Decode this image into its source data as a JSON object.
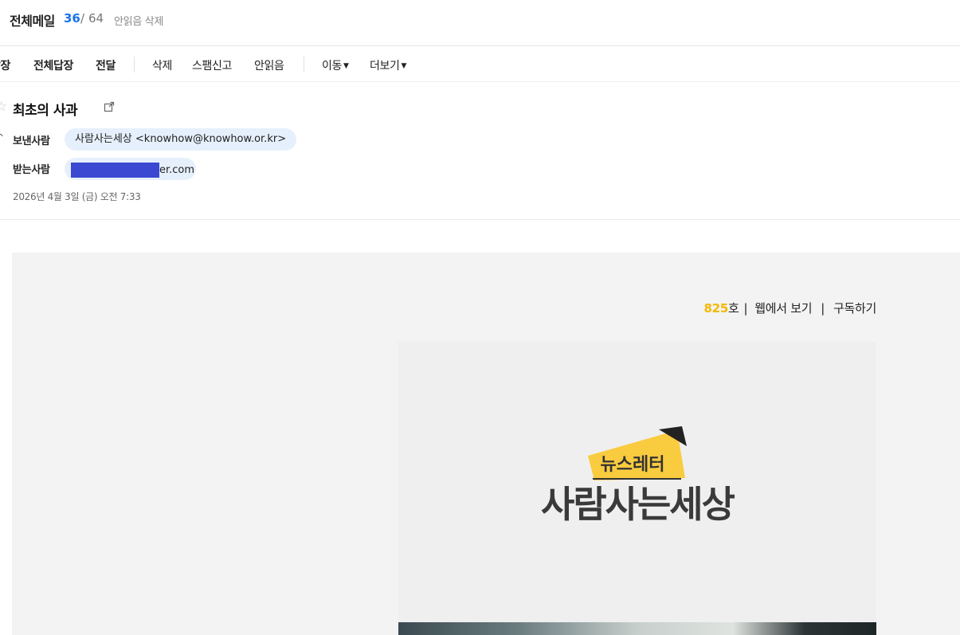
{
  "header": {
    "folder_title": "전체메일",
    "unread_count": "36",
    "separator": "/",
    "total_count": "64",
    "delete_unread_label": "안읽음 삭제"
  },
  "toolbar": {
    "reply_label": "답장",
    "reply_all_label": "전체답장",
    "forward_label": "전달",
    "delete_label": "삭제",
    "spam_label": "스팸신고",
    "unread_label": "안읽음",
    "move_label": "이동",
    "more_label": "더보기"
  },
  "mail": {
    "subject": "최초의 사과",
    "sender_label": "보낸사람",
    "sender_value": "사람사는세상 <knowhow@knowhow.or.kr>",
    "receiver_label": "받는사람",
    "receiver_visible_tail": "er.com",
    "date": "2026년 4월 3일 (금) 오전 7:33"
  },
  "newsletter": {
    "issue_number": "825",
    "issue_suffix": "호",
    "bar1": "|",
    "view_web_label": "웹에서 보기",
    "bar2": "|",
    "subscribe_label": "구독하기",
    "logo_small_text": "뉴스레터",
    "logo_main_text": "사람사는세상"
  },
  "colors": {
    "accent_blue": "#1a73e8",
    "issue_yellow": "#f5b800",
    "logo_yellow": "#f9cb3e",
    "chip_bg": "#e6f0fc",
    "redaction": "#3b48d1"
  },
  "icons": {
    "back": "chevron-left-icon",
    "star": "star-outline-icon",
    "external": "external-link-icon",
    "expand": "chevron-up-icon"
  }
}
